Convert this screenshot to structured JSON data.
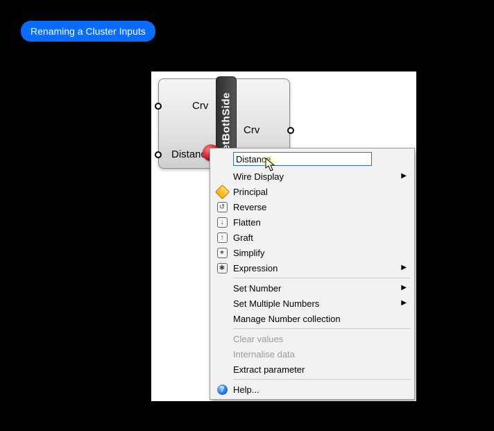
{
  "title": "Renaming a Cluster Inputs",
  "node": {
    "name": "setBothSide",
    "inputs": [
      "Crv",
      "Distance"
    ],
    "outputs": [
      "Crv"
    ]
  },
  "menu": {
    "input_value": "Distance",
    "items": [
      {
        "label": "Wire Display",
        "icon": "",
        "submenu": true
      },
      {
        "label": "Principal",
        "icon": "principal",
        "submenu": false
      },
      {
        "label": "Reverse",
        "icon": "reverse",
        "submenu": false
      },
      {
        "label": "Flatten",
        "icon": "flatten",
        "submenu": false
      },
      {
        "label": "Graft",
        "icon": "graft",
        "submenu": false
      },
      {
        "label": "Simplify",
        "icon": "simplify",
        "submenu": false
      },
      {
        "label": "Expression",
        "icon": "expression",
        "submenu": true
      }
    ],
    "set_items": [
      {
        "label": "Set Number",
        "submenu": true
      },
      {
        "label": "Set Multiple Numbers",
        "submenu": true
      },
      {
        "label": "Manage Number collection",
        "submenu": false
      }
    ],
    "data_items": [
      {
        "label": "Clear values",
        "enabled": false
      },
      {
        "label": "Internalise data",
        "enabled": false
      },
      {
        "label": "Extract parameter",
        "enabled": true
      }
    ],
    "help_label": "Help..."
  }
}
